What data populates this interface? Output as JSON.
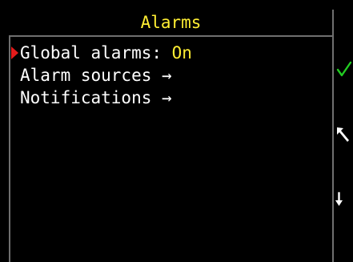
{
  "header": {
    "title": "Alarms"
  },
  "menu": {
    "items": [
      {
        "label": "Global alarms: ",
        "value": "On",
        "selected": true
      },
      {
        "label": "Alarm sources →"
      },
      {
        "label": "Notifications →"
      }
    ]
  },
  "softkeys": {
    "confirm_icon": "check-icon",
    "back_icon": "arrow-up-left-icon",
    "down_icon": "arrow-down-icon"
  },
  "colors": {
    "background": "#000000",
    "title_text": "#ffee33",
    "value_text": "#ffee33",
    "menu_text": "#ffffff",
    "cursor": "#e41b1b",
    "confirm": "#22cc22",
    "divider": "#6f6f6f"
  }
}
